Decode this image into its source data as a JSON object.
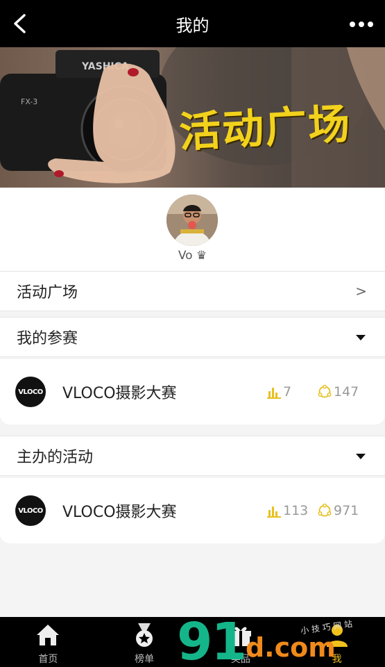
{
  "header": {
    "title": "我的"
  },
  "banner": {
    "title": "活动广场"
  },
  "profile": {
    "nickname": "Vo ♛"
  },
  "menu": {
    "activity_square": "活动广场",
    "activity_square_arrow": ">",
    "my_entries": "我的参赛",
    "hosted_activities": "主办的活动"
  },
  "my_entries": [
    {
      "logo": "VLOCO",
      "name": "VLOCO摄影大赛",
      "rank": "7",
      "views": "147"
    }
  ],
  "hosted": [
    {
      "logo": "VLOCO",
      "name": "VLOCO摄影大赛",
      "rank": "113",
      "views": "971"
    }
  ],
  "tabbar": {
    "items": [
      {
        "label": "首页",
        "icon": "home-icon"
      },
      {
        "label": "榜单",
        "icon": "medal-icon"
      },
      {
        "label": "奖品",
        "icon": "gift-icon"
      },
      {
        "label": "我",
        "icon": "user-icon",
        "active": true
      }
    ]
  },
  "watermark": {
    "main": "91",
    "com": "d.com",
    "sub": "小  技  巧  网  站"
  },
  "colors": {
    "accent": "#f2c21c",
    "topbar": "#000000",
    "stat": "#e8c020"
  }
}
